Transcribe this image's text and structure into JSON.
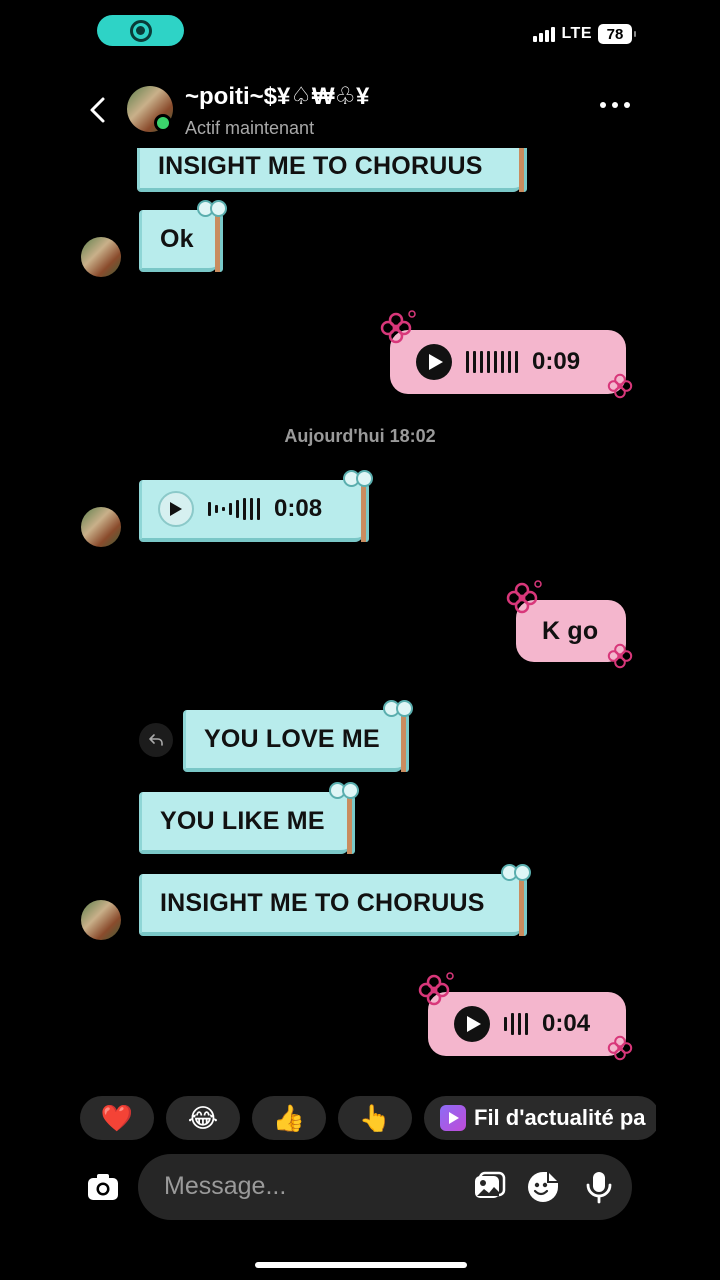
{
  "status_bar": {
    "network": "LTE",
    "battery": "78"
  },
  "header": {
    "name": "~poiti~$¥♤₩♧¥",
    "status": "Actif maintenant"
  },
  "messages": {
    "m0": {
      "text": "INSIGHT ME TO CHORUUS"
    },
    "m1": {
      "text": "Ok"
    },
    "m2": {
      "duration": "0:09"
    },
    "ts": {
      "text": "Aujourd'hui 18:02"
    },
    "m3": {
      "duration": "0:08"
    },
    "m4": {
      "text": "K go"
    },
    "m5": {
      "text": "YOU LOVE ME"
    },
    "m6": {
      "text": "YOU LIKE ME"
    },
    "m7": {
      "text": "INSIGHT ME TO CHORUUS"
    },
    "m8": {
      "duration": "0:04"
    }
  },
  "reactions": {
    "r1": "❤️",
    "r2": "😂",
    "r3": "👍",
    "r4": "👆",
    "feed_label": "Fil d'actualité pa"
  },
  "composer": {
    "placeholder": "Message..."
  },
  "icons": [
    "camera-icon",
    "gallery-icon",
    "sticker-icon",
    "microphone-icon",
    "back-chevron-icon",
    "more-icon",
    "play-icon",
    "reply-icon"
  ],
  "colors": {
    "incoming_bubble": "#b8ecec",
    "outgoing_bubble": "#f4b6cd",
    "online": "#3bd36b",
    "status_pill": "#2ed3c6"
  }
}
